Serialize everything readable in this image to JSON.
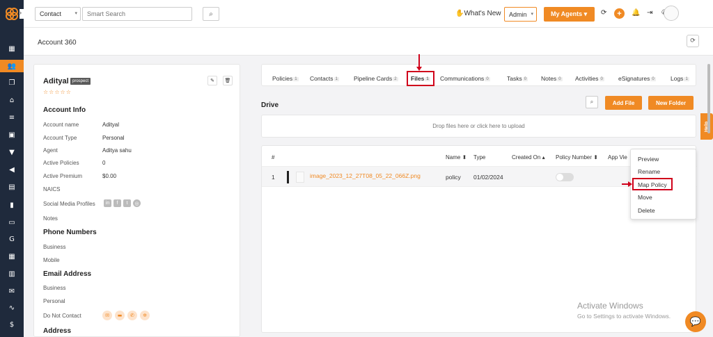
{
  "topbar": {
    "contact_select": "Contact",
    "search_placeholder": "Smart Search",
    "whats_new": "What's New",
    "role_select": "Admin",
    "my_agents": "My Agents"
  },
  "page": {
    "title": "Account 360"
  },
  "account": {
    "name": "Adityal",
    "badge": "prospect",
    "stars": "☆☆☆☆☆",
    "account_info_title": "Account Info",
    "fields": [
      {
        "label": "Account name",
        "value": "Adityal"
      },
      {
        "label": "Account Type",
        "value": "Personal"
      },
      {
        "label": "Agent",
        "value": "Aditya sahu"
      },
      {
        "label": "Active Policies",
        "value": "0"
      },
      {
        "label": "Active Premium",
        "value": "$0.00"
      },
      {
        "label": "NAICS",
        "value": ""
      },
      {
        "label": "Social Media Profiles",
        "value": ""
      },
      {
        "label": "Notes",
        "value": ""
      }
    ],
    "phone_title": "Phone Numbers",
    "phone_fields": [
      "Business",
      "Mobile"
    ],
    "email_title": "Email Address",
    "email_fields": [
      "Business",
      "Personal"
    ],
    "do_not_contact": "Do Not Contact",
    "address_title": "Address"
  },
  "tabs": [
    {
      "label": "Policies",
      "count": "1"
    },
    {
      "label": "Contacts",
      "count": "1"
    },
    {
      "label": "Pipeline Cards",
      "count": "2"
    },
    {
      "label": "Files",
      "count": "1"
    },
    {
      "label": "Communications",
      "count": "0"
    },
    {
      "label": "Tasks",
      "count": "0"
    },
    {
      "label": "Notes",
      "count": "0"
    },
    {
      "label": "Activities",
      "count": "0"
    },
    {
      "label": "eSignatures",
      "count": "0"
    },
    {
      "label": "Logs",
      "count": "1"
    }
  ],
  "drive": {
    "title": "Drive",
    "add_file": "Add File",
    "new_folder": "New Folder",
    "dropzone": "Drop files here or click here to upload",
    "columns": [
      "#",
      "Name ⬍",
      "Type",
      "Created On ▴",
      "Policy Number ⬍",
      "App Vie"
    ],
    "rows": [
      {
        "num": "1",
        "name": "image_2023_12_27T08_05_22_066Z.png",
        "type": "policy",
        "created": "01/02/2024"
      }
    ]
  },
  "context_menu": {
    "items": [
      "Preview",
      "Rename",
      "Map Policy",
      "Move",
      "Delete"
    ]
  },
  "help": "Help",
  "watermark": {
    "line1": "Activate Windows",
    "line2": "Go to Settings to activate Windows."
  },
  "colors": {
    "accent": "#f08a24",
    "sidebar": "#1f2a3c",
    "highlight": "#d0021b"
  }
}
